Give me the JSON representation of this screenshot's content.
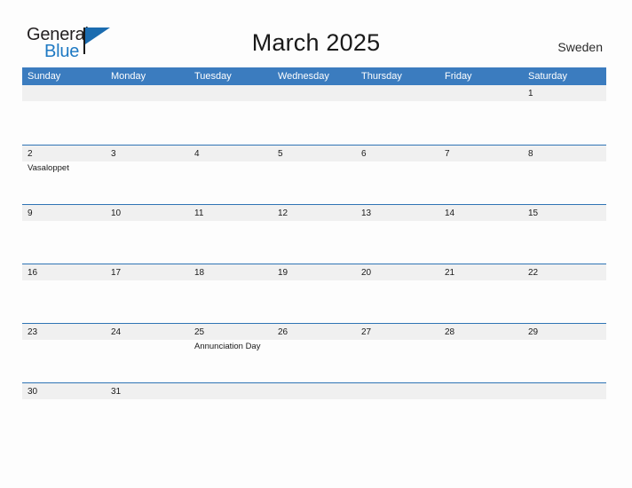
{
  "brand": {
    "name_part1": "General",
    "name_part2": "Blue",
    "flag_icon": "flag-triangle-icon"
  },
  "header": {
    "title": "March 2025",
    "country": "Sweden"
  },
  "colors": {
    "header_blue": "#3b7cbf",
    "rule_blue": "#2f74b5",
    "date_band_gray": "#f0f0f0",
    "brand_blue": "#1e79c3",
    "text": "#1a1a1a"
  },
  "calendar": {
    "weekday_headers": [
      "Sunday",
      "Monday",
      "Tuesday",
      "Wednesday",
      "Thursday",
      "Friday",
      "Saturday"
    ],
    "weeks": [
      {
        "days": [
          {
            "date": "",
            "event": ""
          },
          {
            "date": "",
            "event": ""
          },
          {
            "date": "",
            "event": ""
          },
          {
            "date": "",
            "event": ""
          },
          {
            "date": "",
            "event": ""
          },
          {
            "date": "",
            "event": ""
          },
          {
            "date": "1",
            "event": ""
          }
        ]
      },
      {
        "days": [
          {
            "date": "2",
            "event": "Vasaloppet"
          },
          {
            "date": "3",
            "event": ""
          },
          {
            "date": "4",
            "event": ""
          },
          {
            "date": "5",
            "event": ""
          },
          {
            "date": "6",
            "event": ""
          },
          {
            "date": "7",
            "event": ""
          },
          {
            "date": "8",
            "event": ""
          }
        ]
      },
      {
        "days": [
          {
            "date": "9",
            "event": ""
          },
          {
            "date": "10",
            "event": ""
          },
          {
            "date": "11",
            "event": ""
          },
          {
            "date": "12",
            "event": ""
          },
          {
            "date": "13",
            "event": ""
          },
          {
            "date": "14",
            "event": ""
          },
          {
            "date": "15",
            "event": ""
          }
        ]
      },
      {
        "days": [
          {
            "date": "16",
            "event": ""
          },
          {
            "date": "17",
            "event": ""
          },
          {
            "date": "18",
            "event": ""
          },
          {
            "date": "19",
            "event": ""
          },
          {
            "date": "20",
            "event": ""
          },
          {
            "date": "21",
            "event": ""
          },
          {
            "date": "22",
            "event": ""
          }
        ]
      },
      {
        "days": [
          {
            "date": "23",
            "event": ""
          },
          {
            "date": "24",
            "event": ""
          },
          {
            "date": "25",
            "event": "Annunciation Day"
          },
          {
            "date": "26",
            "event": ""
          },
          {
            "date": "27",
            "event": ""
          },
          {
            "date": "28",
            "event": ""
          },
          {
            "date": "29",
            "event": ""
          }
        ]
      },
      {
        "days": [
          {
            "date": "30",
            "event": ""
          },
          {
            "date": "31",
            "event": ""
          },
          {
            "date": "",
            "event": ""
          },
          {
            "date": "",
            "event": ""
          },
          {
            "date": "",
            "event": ""
          },
          {
            "date": "",
            "event": ""
          },
          {
            "date": "",
            "event": ""
          }
        ]
      }
    ]
  }
}
